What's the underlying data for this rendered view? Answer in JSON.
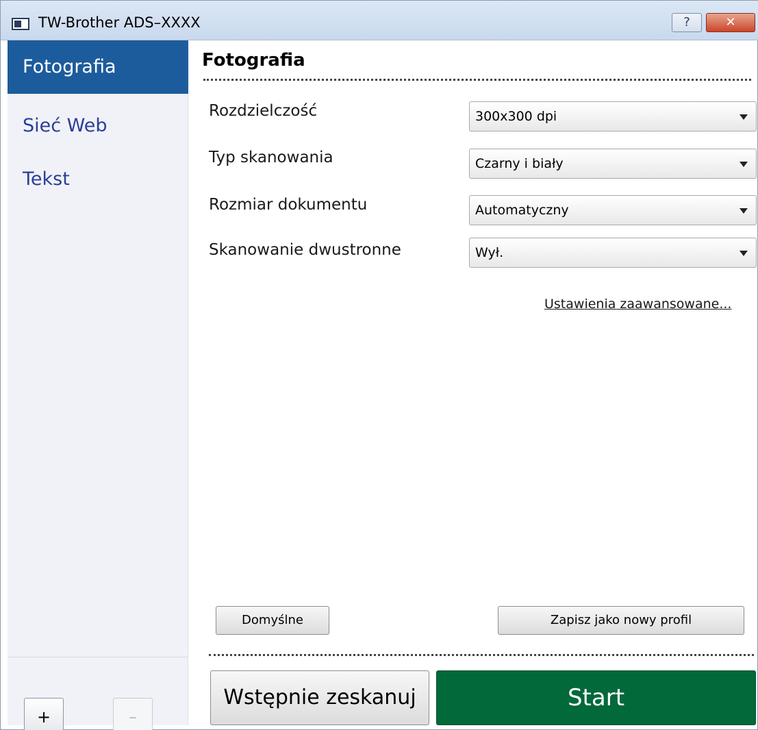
{
  "window": {
    "title": "TW-Brother ADS–XXXX",
    "help_label": "?",
    "close_label": "✕"
  },
  "sidebar": {
    "items": [
      {
        "label": "Fotografia",
        "active": true
      },
      {
        "label": "Sieć Web",
        "active": false
      },
      {
        "label": "Tekst",
        "active": false
      }
    ],
    "add_label": "+",
    "remove_label": "–"
  },
  "main": {
    "section_title": "Fotografia",
    "settings": [
      {
        "label": "Rozdzielczość",
        "value": "300x300 dpi"
      },
      {
        "label": "Typ skanowania",
        "value": "Czarny i biały"
      },
      {
        "label": "Rozmiar dokumentu",
        "value": "Automatyczny"
      },
      {
        "label": "Skanowanie dwustronne",
        "value": "Wył."
      }
    ],
    "advanced_link": "Ustawienia zaawansowane...",
    "default_button": "Domyślne",
    "save_profile_button": "Zapisz jako nowy profil",
    "prescan_button": "Wstępnie zeskanuj",
    "start_button": "Start"
  },
  "colors": {
    "sidebar_active": "#1d5c9c",
    "start_button": "#02693a",
    "sidebar_link": "#2c3e9a"
  }
}
